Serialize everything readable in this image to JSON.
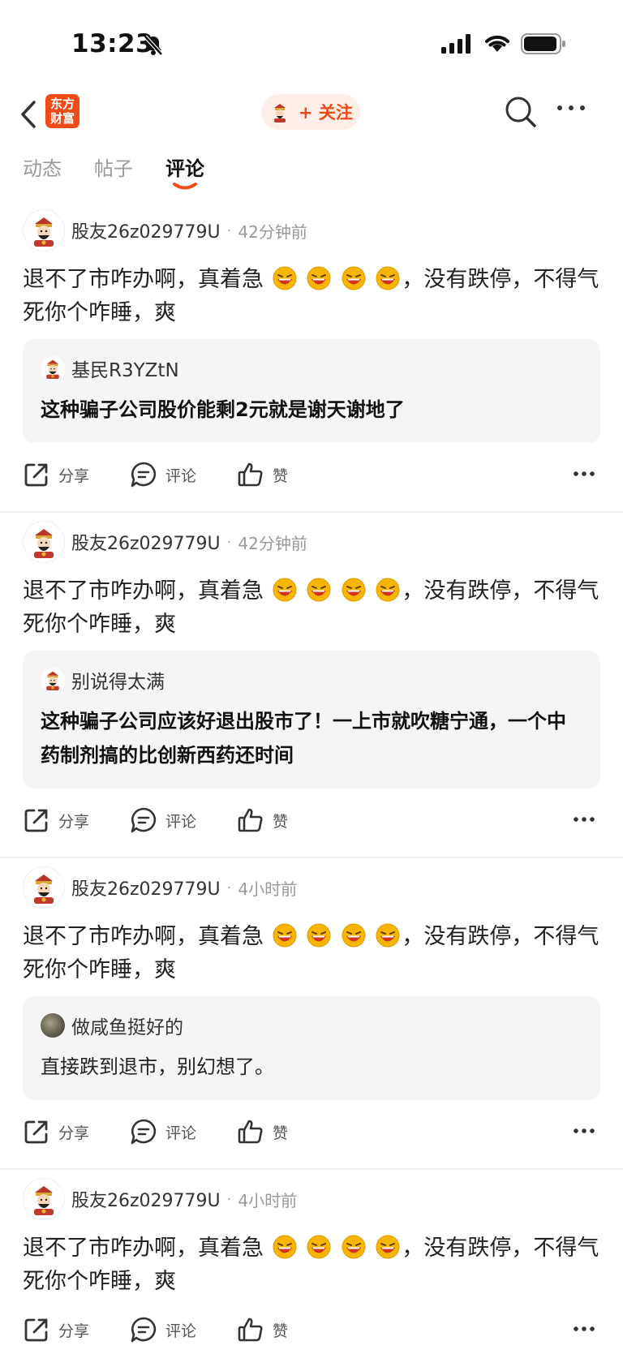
{
  "status_bar": {
    "time": "13:23"
  },
  "header": {
    "logo_text": "东方\n财富",
    "follow_label": "+ 关注"
  },
  "tabs": [
    {
      "label": "动态"
    },
    {
      "label": "帖子"
    },
    {
      "label": "评论",
      "active": true
    }
  ],
  "actions": {
    "share": "分享",
    "comment": "评论",
    "like": "赞"
  },
  "posts": [
    {
      "author": "股友26z029779U",
      "time": "42分钟前",
      "text_before": "退不了市咋办啊，真着急",
      "emoji_count": 4,
      "text_after": "，没有跌停，不得气死你个咋睡，爽",
      "quote": {
        "author": "基民R3YZtN",
        "text": "这种骗子公司股价能剩2元就是谢天谢地了",
        "bold": true,
        "avatar": "caishen"
      }
    },
    {
      "author": "股友26z029779U",
      "time": "42分钟前",
      "text_before": "退不了市咋办啊，真着急",
      "emoji_count": 4,
      "text_after": "，没有跌停，不得气死你个咋睡，爽",
      "quote": {
        "author": "别说得太满",
        "text": "这种骗子公司应该好退出股市了！一上市就吹糖宁通，一个中药制剂搞的比创新西药还时间",
        "bold": true,
        "avatar": "caishen"
      }
    },
    {
      "author": "股友26z029779U",
      "time": "4小时前",
      "text_before": "退不了市咋办啊，真着急",
      "emoji_count": 4,
      "text_after": "，没有跌停，不得气死你个咋睡，爽",
      "quote": {
        "author": "做咸鱼挺好的",
        "text": "直接跌到退市，别幻想了。",
        "bold": false,
        "avatar": "photo"
      }
    },
    {
      "author": "股友26z029779U",
      "time": "4小时前",
      "text_before": "退不了市咋办啊，真着急",
      "emoji_count": 4,
      "text_after": "，没有跌停，不得气死你个咋睡，爽"
    }
  ],
  "colors": {
    "brand": "#f04b16",
    "follow_bg": "#fdeee8",
    "quote_bg": "#f5f5f7"
  }
}
